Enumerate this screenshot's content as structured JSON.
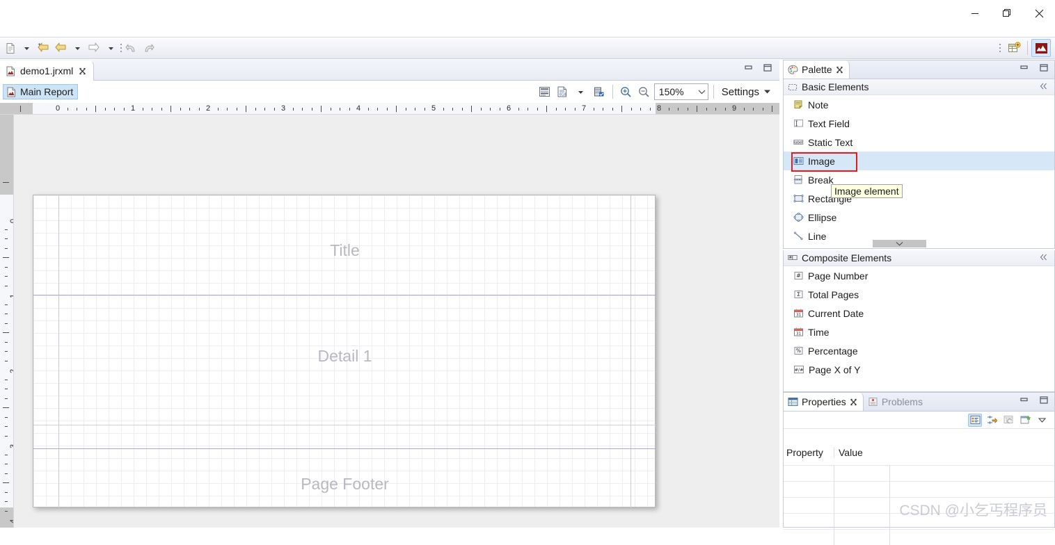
{
  "window": {
    "controls": [
      {
        "name": "minimize-button",
        "glyph": "minimize-icon"
      },
      {
        "name": "restore-button",
        "glyph": "restore-icon"
      },
      {
        "name": "close-button",
        "glyph": "close-icon"
      }
    ]
  },
  "toolbar": {
    "items": [
      {
        "name": "new-wizard-button",
        "icon": "new-file-icon",
        "has_dropdown": true
      },
      {
        "name": "back-history-button",
        "icon": "back-arrow-star-icon",
        "has_dropdown": false
      },
      {
        "name": "back-button",
        "icon": "back-arrow-icon",
        "has_dropdown": true
      },
      {
        "name": "forward-button",
        "icon": "forward-arrow-icon",
        "has_dropdown": true
      },
      {
        "name": "undo-button",
        "icon": "undo-icon",
        "has_dropdown": false
      },
      {
        "name": "redo-button",
        "icon": "redo-icon",
        "has_dropdown": false
      }
    ],
    "perspectives": [
      {
        "name": "open-perspective-button",
        "icon": "open-perspective-icon",
        "active": false
      },
      {
        "name": "report-design-perspective-button",
        "icon": "jasper-report-icon",
        "active": true
      }
    ]
  },
  "editor": {
    "tab": {
      "title": "demo1.jrxml",
      "icon": "jrxml-file-icon",
      "close_glyph": "close-icon"
    },
    "view_controls": [
      {
        "name": "minimize-editor-button",
        "glyph": "minimize-icon"
      },
      {
        "name": "maximize-editor-button",
        "glyph": "maximize-icon"
      }
    ],
    "report_tab": {
      "label": "Main Report",
      "icon": "jrxml-file-icon"
    },
    "toolbar": {
      "buttons": [
        {
          "name": "show-bands-button",
          "icon": "bands-icon"
        },
        {
          "name": "show-data-button",
          "icon": "data-preview-icon",
          "has_dropdown": true
        },
        {
          "name": "compile-report-button",
          "icon": "compile-icon"
        },
        {
          "name": "zoom-in-button",
          "icon": "zoom-in-icon"
        },
        {
          "name": "zoom-out-button",
          "icon": "zoom-out-icon"
        }
      ],
      "zoom": {
        "value": "150%",
        "dropdown_glyph": "chevron-down-icon"
      },
      "settings": {
        "label": "Settings",
        "dropdown_glyph": "chevron-down-icon"
      }
    },
    "ruler": {
      "horizontal_labels": [
        "0",
        "1",
        "2",
        "3",
        "4",
        "5",
        "6",
        "7",
        "8",
        "9"
      ],
      "vertical_labels": [
        "0",
        "1",
        "2",
        "3",
        "4"
      ],
      "unit": "inch"
    },
    "canvas": {
      "bands": [
        {
          "name": "title-band",
          "label": "Title"
        },
        {
          "name": "detail-band",
          "label": "Detail 1"
        },
        {
          "name": "page-footer-band",
          "label": "Page Footer"
        }
      ]
    }
  },
  "palette": {
    "tab": {
      "label": "Palette",
      "icon": "palette-icon",
      "close_glyph": "close-icon"
    },
    "view_controls": [
      {
        "name": "minimize-palette-button",
        "glyph": "minimize-icon"
      },
      {
        "name": "maximize-palette-button",
        "glyph": "maximize-icon"
      }
    ],
    "sections": [
      {
        "name": "basic-elements",
        "title": "Basic Elements",
        "icon": "basic-elements-icon",
        "collapse_glyph": "collapse-all-icon",
        "items": [
          {
            "label": "Note",
            "icon": "note-icon",
            "selected": false
          },
          {
            "label": "Text Field",
            "icon": "text-field-icon",
            "selected": false
          },
          {
            "label": "Static Text",
            "icon": "static-text-icon",
            "selected": false
          },
          {
            "label": "Image",
            "icon": "image-icon",
            "selected": true
          },
          {
            "label": "Break",
            "icon": "break-icon",
            "selected": false
          },
          {
            "label": "Rectangle",
            "icon": "rectangle-icon",
            "selected": false
          },
          {
            "label": "Ellipse",
            "icon": "ellipse-icon",
            "selected": false
          },
          {
            "label": "Line",
            "icon": "line-icon",
            "selected": false
          }
        ],
        "scroll_down_glyph": "chevron-down-icon"
      },
      {
        "name": "composite-elements",
        "title": "Composite Elements",
        "icon": "composite-elements-icon",
        "collapse_glyph": "collapse-all-icon",
        "items": [
          {
            "label": "Page Number",
            "icon": "page-number-icon",
            "selected": false
          },
          {
            "label": "Total Pages",
            "icon": "total-pages-icon",
            "selected": false
          },
          {
            "label": "Current Date",
            "icon": "calendar-icon",
            "selected": false
          },
          {
            "label": "Time",
            "icon": "calendar-icon",
            "selected": false
          },
          {
            "label": "Percentage",
            "icon": "percentage-icon",
            "selected": false
          },
          {
            "label": "Page X of Y",
            "icon": "page-x-of-y-icon",
            "selected": false
          }
        ]
      }
    ],
    "tooltip": {
      "text": "Image element"
    }
  },
  "properties": {
    "tabs": [
      {
        "label": "Properties",
        "icon": "properties-icon",
        "active": true,
        "close_glyph": "close-icon"
      },
      {
        "label": "Problems",
        "icon": "problems-icon",
        "active": false
      }
    ],
    "view_controls": [
      {
        "name": "minimize-properties-button",
        "glyph": "minimize-icon"
      },
      {
        "name": "maximize-properties-button",
        "glyph": "maximize-icon"
      }
    ],
    "toolbar_buttons": [
      {
        "name": "show-categories-button",
        "icon": "categories-icon",
        "active": true
      },
      {
        "name": "show-advanced-button",
        "icon": "advanced-icon",
        "active": false
      },
      {
        "name": "restore-default-button",
        "icon": "restore-default-icon",
        "active": false
      },
      {
        "name": "new-property-button",
        "icon": "new-property-icon",
        "active": false
      },
      {
        "name": "view-menu-button",
        "icon": "chevron-down-icon",
        "active": false
      }
    ],
    "columns": [
      "Property",
      "Value"
    ],
    "rows": []
  },
  "watermark": {
    "text": "CSDN @小乞丐程序员"
  },
  "colors": {
    "accent": "#cde4f7",
    "selection_border": "#9ec8ea",
    "highlight_red": "#e81a1a",
    "tooltip_bg": "#ffffe1",
    "band_line": "#a9a9e0",
    "band_label": "#b8b8bf"
  }
}
